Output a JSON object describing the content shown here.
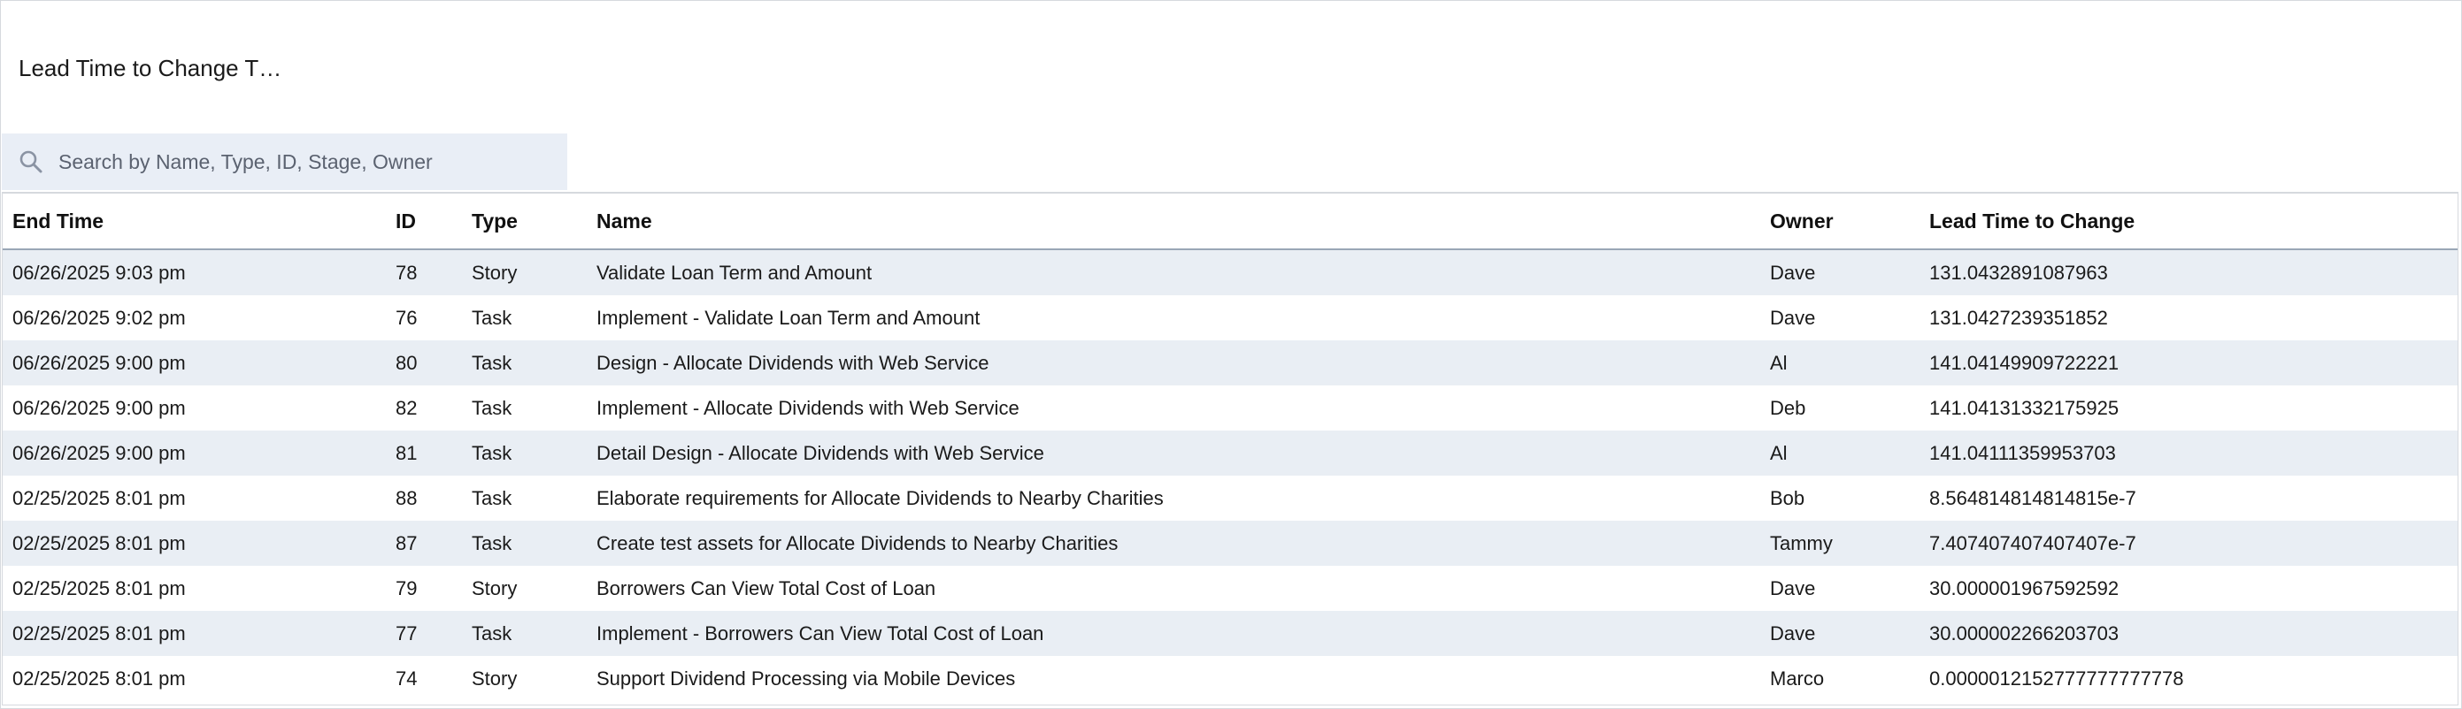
{
  "widget": {
    "title": "Lead Time to Change T…"
  },
  "search": {
    "placeholder": "Search by Name, Type, ID, Stage, Owner",
    "value": ""
  },
  "table": {
    "columns": {
      "end_time": "End Time",
      "id": "ID",
      "type": "Type",
      "name": "Name",
      "owner": "Owner",
      "lead_time": "Lead Time to Change"
    },
    "rows": [
      {
        "end_time": "06/26/2025 9:03 pm",
        "id": "78",
        "type": "Story",
        "name": "Validate Loan Term and Amount",
        "owner": "Dave",
        "lead_time": "131.0432891087963"
      },
      {
        "end_time": "06/26/2025 9:02 pm",
        "id": "76",
        "type": "Task",
        "name": "Implement - Validate Loan Term and Amount",
        "owner": "Dave",
        "lead_time": "131.0427239351852"
      },
      {
        "end_time": "06/26/2025 9:00 pm",
        "id": "80",
        "type": "Task",
        "name": "Design - Allocate Dividends with Web Service",
        "owner": "Al",
        "lead_time": "141.04149909722221"
      },
      {
        "end_time": "06/26/2025 9:00 pm",
        "id": "82",
        "type": "Task",
        "name": "Implement - Allocate Dividends with Web Service",
        "owner": "Deb",
        "lead_time": "141.04131332175925"
      },
      {
        "end_time": "06/26/2025 9:00 pm",
        "id": "81",
        "type": "Task",
        "name": "Detail Design - Allocate Dividends with Web Service",
        "owner": "Al",
        "lead_time": "141.04111359953703"
      },
      {
        "end_time": "02/25/2025 8:01 pm",
        "id": "88",
        "type": "Task",
        "name": "Elaborate requirements for Allocate Dividends to Nearby Charities",
        "owner": "Bob",
        "lead_time": "8.564814814814815e-7"
      },
      {
        "end_time": "02/25/2025 8:01 pm",
        "id": "87",
        "type": "Task",
        "name": "Create test assets for Allocate Dividends to Nearby Charities",
        "owner": "Tammy",
        "lead_time": "7.407407407407407e-7"
      },
      {
        "end_time": "02/25/2025 8:01 pm",
        "id": "79",
        "type": "Story",
        "name": "Borrowers Can View Total Cost of Loan",
        "owner": "Dave",
        "lead_time": "30.000001967592592"
      },
      {
        "end_time": "02/25/2025 8:01 pm",
        "id": "77",
        "type": "Task",
        "name": "Implement - Borrowers Can View Total Cost of Loan",
        "owner": "Dave",
        "lead_time": "30.000002266203703"
      },
      {
        "end_time": "02/25/2025 8:01 pm",
        "id": "74",
        "type": "Story",
        "name": "Support Dividend Processing via Mobile Devices",
        "owner": "Marco",
        "lead_time": "0.0000012152777777777778"
      }
    ]
  },
  "colors": {
    "search_bg": "#e9eef6",
    "row_stripe": "#e9eef4",
    "header_rule": "#9aa7b6",
    "border": "#d6d9de"
  }
}
